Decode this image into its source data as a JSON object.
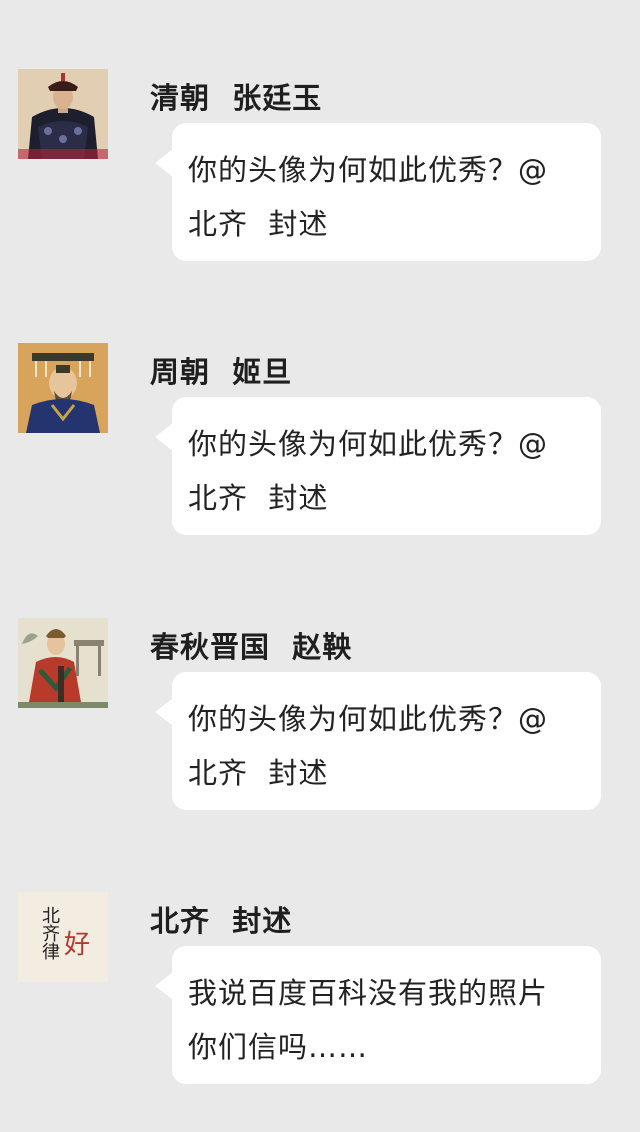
{
  "messages": [
    {
      "avatar_icon": "qing-official-portrait-icon",
      "sender": "清朝  张廷玉",
      "lines": [
        "你的头像为何如此优秀？@",
        "北齐  封述"
      ]
    },
    {
      "avatar_icon": "zhou-king-portrait-icon",
      "sender": "周朝  姬旦",
      "lines": [
        "你的头像为何如此优秀？@",
        "北齐  封述"
      ]
    },
    {
      "avatar_icon": "spring-autumn-figure-portrait-icon",
      "sender": "春秋晋国  赵鞅",
      "lines": [
        "你的头像为何如此优秀？@",
        "北齐  封述"
      ]
    },
    {
      "avatar_icon": "calligraphy-avatar-icon",
      "avatar_text": {
        "col1": "北齐律",
        "accent": "好"
      },
      "sender": "北齐  封述",
      "lines": [
        "我说百度百科没有我的照片",
        "你们信吗……"
      ]
    }
  ],
  "colors": {
    "background": "#e9e9e9",
    "bubble": "#ffffff",
    "text": "#222222",
    "accent_red": "#b03a2e"
  }
}
